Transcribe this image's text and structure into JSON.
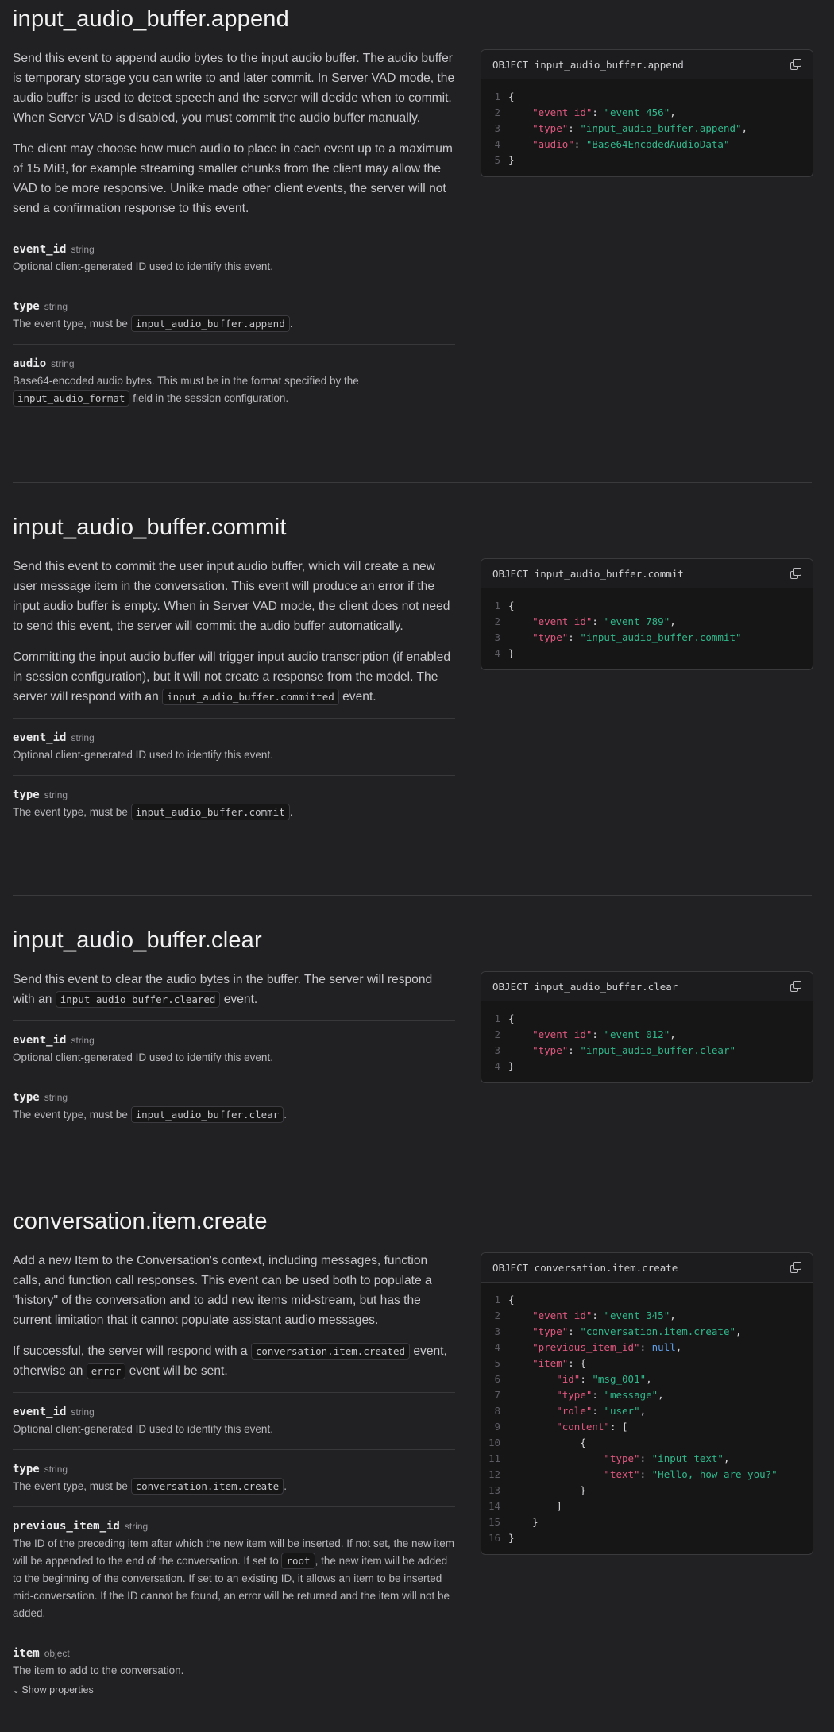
{
  "sections": [
    {
      "title": "input_audio_buffer.append",
      "paragraphs": [
        [
          "Send this event to append audio bytes to the input audio buffer. The audio buffer is temporary storage you can write to and later commit. In Server VAD mode, the audio buffer is used to detect speech and the server will decide when to commit. When Server VAD is disabled, you must commit the audio buffer manually."
        ],
        [
          "The client may choose how much audio to place in each event up to a maximum of 15 MiB, for example streaming smaller chunks from the client may allow the VAD to be more responsive. Unlike made other client events, the server will not send a confirmation response to this event."
        ]
      ],
      "fields": [
        {
          "name": "event_id",
          "type": "string",
          "desc": [
            "Optional client-generated ID used to identify this event."
          ]
        },
        {
          "name": "type",
          "type": "string",
          "desc": [
            "The event type, must be ",
            "input_audio_buffer.append",
            "."
          ]
        },
        {
          "name": "audio",
          "type": "string",
          "desc": [
            "Base64-encoded audio bytes. This must be in the format specified by the ",
            "input_audio_format",
            " field in the session configuration."
          ]
        }
      ],
      "code_header": "OBJECT input_audio_buffer.append",
      "code_lines": [
        "{",
        "    \"event_id\": \"event_456\",",
        "    \"type\": \"input_audio_buffer.append\",",
        "    \"audio\": \"Base64EncodedAudioData\"",
        "}"
      ]
    },
    {
      "title": "input_audio_buffer.commit",
      "paragraphs": [
        [
          "Send this event to commit the user input audio buffer, which will create a new user message item in the conversation. This event will produce an error if the input audio buffer is empty. When in Server VAD mode, the client does not need to send this event, the server will commit the audio buffer automatically."
        ],
        [
          "Committing the input audio buffer will trigger input audio transcription (if enabled in session configuration), but it will not create a response from the model. The server will respond with an ",
          "input_audio_buffer.committed",
          " event."
        ]
      ],
      "fields": [
        {
          "name": "event_id",
          "type": "string",
          "desc": [
            "Optional client-generated ID used to identify this event."
          ]
        },
        {
          "name": "type",
          "type": "string",
          "desc": [
            "The event type, must be ",
            "input_audio_buffer.commit",
            "."
          ]
        }
      ],
      "code_header": "OBJECT input_audio_buffer.commit",
      "code_lines": [
        "{",
        "    \"event_id\": \"event_789\",",
        "    \"type\": \"input_audio_buffer.commit\"",
        "}"
      ]
    },
    {
      "title": "input_audio_buffer.clear",
      "paragraphs": [
        [
          "Send this event to clear the audio bytes in the buffer. The server will respond with an ",
          "input_audio_buffer.cleared",
          " event."
        ]
      ],
      "fields": [
        {
          "name": "event_id",
          "type": "string",
          "desc": [
            "Optional client-generated ID used to identify this event."
          ]
        },
        {
          "name": "type",
          "type": "string",
          "desc": [
            "The event type, must be ",
            "input_audio_buffer.clear",
            "."
          ]
        }
      ],
      "code_header": "OBJECT input_audio_buffer.clear",
      "code_lines": [
        "{",
        "    \"event_id\": \"event_012\",",
        "    \"type\": \"input_audio_buffer.clear\"",
        "}"
      ]
    },
    {
      "title": "conversation.item.create",
      "paragraphs": [
        [
          "Add a new Item to the Conversation's context, including messages, function calls, and function call responses. This event can be used both to populate a \"history\" of the conversation and to add new items mid-stream, but has the current limitation that it cannot populate assistant audio messages."
        ],
        [
          "If successful, the server will respond with a ",
          "conversation.item.created",
          " event, otherwise an ",
          "error",
          " event will be sent."
        ]
      ],
      "fields": [
        {
          "name": "event_id",
          "type": "string",
          "desc": [
            "Optional client-generated ID used to identify this event."
          ]
        },
        {
          "name": "type",
          "type": "string",
          "desc": [
            "The event type, must be ",
            "conversation.item.create",
            "."
          ]
        },
        {
          "name": "previous_item_id",
          "type": "string",
          "desc": [
            "The ID of the preceding item after which the new item will be inserted. If not set, the new item will be appended to the end of the conversation. If set to ",
            "root",
            ", the new item will be added to the beginning of the conversation. If set to an existing ID, it allows an item to be inserted mid-conversation. If the ID cannot be found, an error will be returned and the item will not be added."
          ]
        },
        {
          "name": "item",
          "type": "object",
          "desc": [
            "The item to add to the conversation."
          ],
          "show_properties": "Show properties"
        }
      ],
      "code_header": "OBJECT conversation.item.create",
      "code_lines": [
        "{",
        "    \"event_id\": \"event_345\",",
        "    \"type\": \"conversation.item.create\",",
        "    \"previous_item_id\": null,",
        "    \"item\": {",
        "        \"id\": \"msg_001\",",
        "        \"type\": \"message\",",
        "        \"role\": \"user\",",
        "        \"content\": [",
        "            {",
        "                \"type\": \"input_text\",",
        "                \"text\": \"Hello, how are you?\"",
        "            }",
        "        ]",
        "    }",
        "}"
      ]
    }
  ],
  "icons": {
    "copy": "copy-icon",
    "chevron": "chevron-down-icon"
  }
}
